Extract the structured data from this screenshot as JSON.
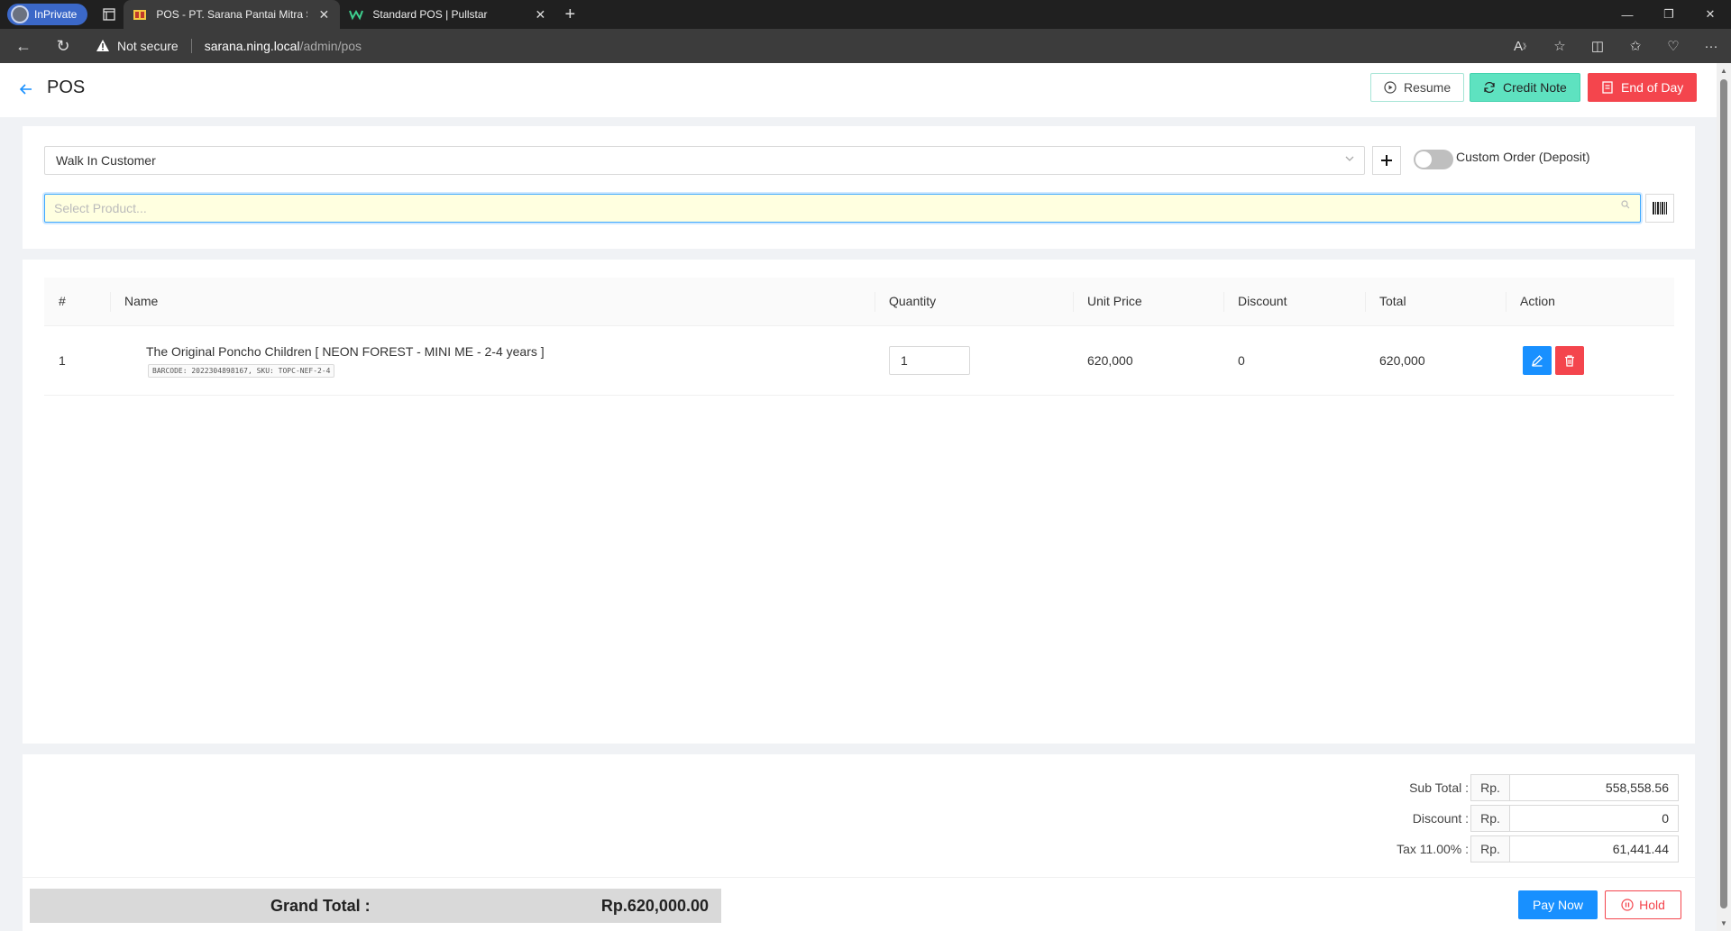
{
  "browser": {
    "inprivate_label": "InPrivate",
    "tabs": [
      {
        "title": "POS - PT. Sarana Pantai Mitra Se",
        "active": true
      },
      {
        "title": "Standard POS | Pullstar",
        "active": false
      }
    ],
    "security_label": "Not secure",
    "url_host": "sarana.ning.local",
    "url_path": "/admin/pos"
  },
  "header": {
    "title": "POS",
    "resume_label": "Resume",
    "credit_note_label": "Credit Note",
    "end_of_day_label": "End of Day"
  },
  "customer": {
    "selected": "Walk In Customer",
    "custom_order_label": "Custom Order (Deposit)",
    "custom_order_on": false
  },
  "product_search": {
    "placeholder": "Select Product..."
  },
  "table": {
    "columns": [
      "#",
      "Name",
      "Quantity",
      "Unit Price",
      "Discount",
      "Total",
      "Action"
    ],
    "rows": [
      {
        "index": "1",
        "name": "The Original Poncho Children [ NEON FOREST - MINI ME - 2-4 years ]",
        "tag": "BARCODE: 2022304898167, SKU: TOPC-NEF-2-4",
        "quantity": "1",
        "unit_price": "620,000",
        "discount": "0",
        "total": "620,000"
      }
    ]
  },
  "summary": {
    "subtotal_label": "Sub Total :",
    "discount_label": "Discount :",
    "tax_label": "Tax 11.00% :",
    "currency": "Rp.",
    "subtotal": "558,558.56",
    "discount": "0",
    "tax": "61,441.44",
    "grand_total_label": "Grand Total :",
    "grand_total": "Rp.620,000.00",
    "pay_now_label": "Pay Now",
    "hold_label": "Hold"
  },
  "colors": {
    "primary": "#1890ff",
    "danger": "#f4454d",
    "teal": "#5ee2c0"
  }
}
